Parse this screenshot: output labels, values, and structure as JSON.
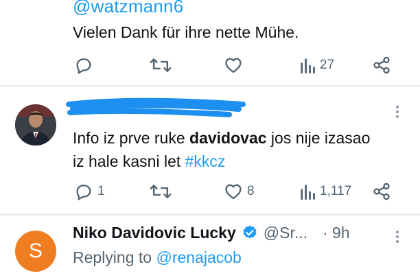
{
  "tweet1": {
    "handle": "@watzmann6",
    "text": "Vielen Dank für ihre nette Mühe.",
    "views": "27"
  },
  "tweet2": {
    "text_before": "Info iz prve ruke ",
    "text_bold": "davidovac",
    "text_after": " jos nije izasao",
    "text_line2": "iz hale kasni let ",
    "hashtag": "#kkcz",
    "replies": "1",
    "likes": "8",
    "views": "1,117"
  },
  "tweet3": {
    "avatar_letter": "S",
    "name": "Niko Davidovic Lucky",
    "handle": "@Sr...",
    "time": "· 9h",
    "replying_prefix": "Replying to ",
    "replying_handle": "@renajacob"
  },
  "colors": {
    "accent": "#1d9bf0",
    "muted": "#536471",
    "avatar_orange": "#ef7d22",
    "verified": "#1d9bf0"
  },
  "icons": [
    "reply-icon",
    "retweet-icon",
    "like-icon",
    "views-icon",
    "share-icon",
    "more-icon",
    "verified-icon"
  ]
}
